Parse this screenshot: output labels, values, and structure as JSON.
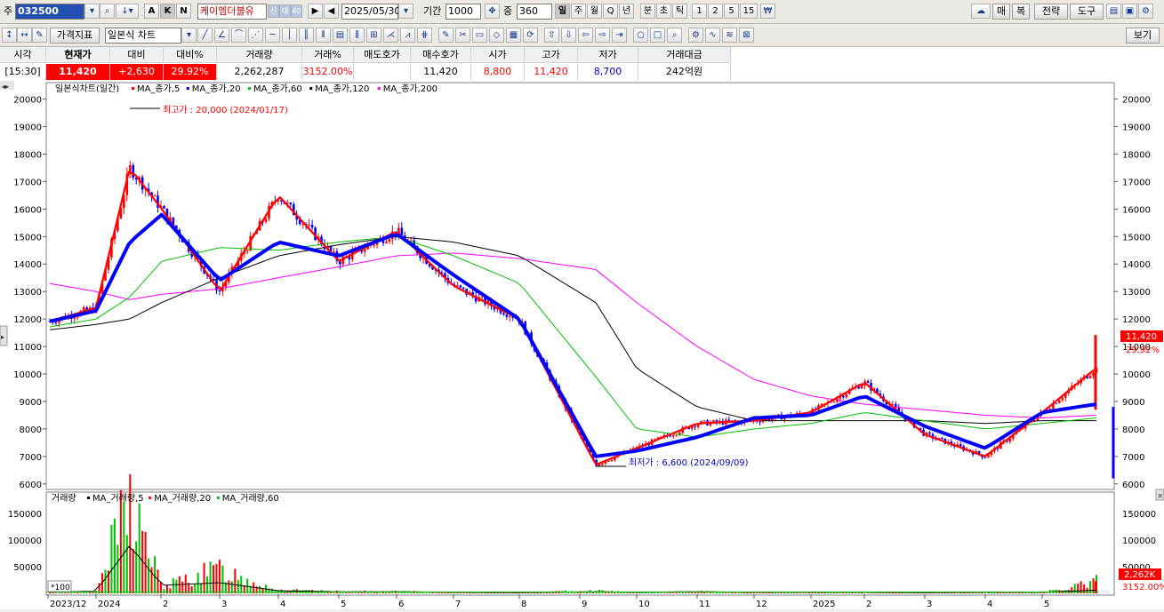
{
  "toolbar1": {
    "market_label": "주",
    "code": "032500",
    "stock_name": "케이엠더블유",
    "badges": [
      "신",
      "대",
      "40"
    ],
    "date": "2025/05/30",
    "period_label": "기간",
    "period_value": "1000",
    "mid_label": "중",
    "mid_value": "360",
    "interval_buttons": [
      "일",
      "주",
      "월",
      "Q",
      "년",
      "분",
      "초",
      "틱",
      "1",
      "2",
      "5",
      "15"
    ],
    "abk_buttons": [
      "A",
      "K",
      "N"
    ],
    "right_buttons": [
      "매",
      "복",
      "전략",
      "도구"
    ]
  },
  "toolbar2": {
    "indicator_label": "가격지표",
    "chart_type": "일본식 차트",
    "view_label": "보기"
  },
  "quote": {
    "headers": [
      "시각",
      "현재가",
      "대비",
      "대비%",
      "거래량",
      "거래%",
      "매도호가",
      "매수호가",
      "시가",
      "고가",
      "저가",
      "거래대금"
    ],
    "values": [
      "[15:30]",
      "11,420",
      "+2,630",
      "29.92%",
      "2,262,287",
      "3152.00%",
      "",
      "11,420",
      "8,800",
      "11,420",
      "8,700",
      "242억원"
    ]
  },
  "price_panel": {
    "legend_title": "일본식차트(일간)",
    "legend_items": [
      {
        "label": "MA_종가,5",
        "color": "#ff0000"
      },
      {
        "label": "MA_종가,20",
        "color": "#0000ff"
      },
      {
        "label": "MA_종가,60",
        "color": "#00c000"
      },
      {
        "label": "MA_종가,120",
        "color": "#000000"
      },
      {
        "label": "MA_종가,200",
        "color": "#ff00ff"
      }
    ],
    "high_annotation": "최고가 : 20,000 (2024/01/17)",
    "low_annotation": "최저가 : 6,600 (2024/09/09)",
    "last_price_tag": "11,420",
    "last_pct_tag": "29.92%"
  },
  "volume_panel": {
    "legend_title": "거래량",
    "legend_items": [
      {
        "label": "MA_거래량,5",
        "color": "#000000"
      },
      {
        "label": "MA_거래량,20",
        "color": "#ff0000"
      },
      {
        "label": "MA_거래량,60",
        "color": "#00c000"
      }
    ],
    "unit_label": "*100",
    "last_volume_tag": "2,262K",
    "last_pct_tag": "3152.00%"
  },
  "x_axis_labels": [
    "2023/12",
    "2024",
    "2",
    "3",
    "4",
    "5",
    "6",
    "7",
    "8",
    "9",
    "10",
    "11",
    "12",
    "2025",
    "2",
    "3",
    "4",
    "5"
  ],
  "colors": {
    "up": "#ff0000",
    "down": "#0000ff",
    "ma5": "#ff0000",
    "ma20": "#0000ff",
    "ma60": "#00c000",
    "ma120": "#000000",
    "ma200": "#ff00ff",
    "current_bg": "#ff0000"
  },
  "chart_data": [
    {
      "type": "line",
      "title": "일본식차트(일간)",
      "x": [
        "2023/12",
        "2024/01",
        "2024/01/17",
        "2024/02",
        "2024/03",
        "2024/04",
        "2024/05",
        "2024/06",
        "2024/07",
        "2024/08",
        "2024/09/09",
        "2024/10",
        "2024/11",
        "2024/12",
        "2025/01",
        "2025/02",
        "2025/03",
        "2025/04",
        "2025/05",
        "2025/05/30"
      ],
      "y_ticks": [
        6000,
        7000,
        8000,
        9000,
        10000,
        11000,
        12000,
        13000,
        14000,
        15000,
        16000,
        17000,
        18000,
        19000,
        20000
      ],
      "ylim": [
        5800,
        20600
      ],
      "grid": false,
      "legend": "top-left",
      "series": [
        {
          "name": "MA_종가,5",
          "values": [
            11900,
            12400,
            17500,
            16000,
            13000,
            16500,
            14100,
            15200,
            13200,
            12000,
            6700,
            7300,
            8200,
            8300,
            8600,
            9700,
            7800,
            7000,
            8600,
            10200
          ]
        },
        {
          "name": "MA_종가,20",
          "values": [
            11900,
            12300,
            14800,
            15800,
            13400,
            14800,
            14300,
            15100,
            13600,
            12000,
            7000,
            7200,
            7700,
            8400,
            8500,
            9200,
            8100,
            7300,
            8600,
            8900
          ]
        },
        {
          "name": "MA_종가,60",
          "values": [
            11700,
            12000,
            12800,
            14100,
            14600,
            14500,
            14800,
            15000,
            14300,
            13300,
            9900,
            8000,
            7700,
            8000,
            8200,
            8600,
            8300,
            8000,
            8200,
            8400
          ]
        },
        {
          "name": "MA_종가,120",
          "values": [
            11600,
            11800,
            12000,
            12600,
            13500,
            14300,
            14700,
            15000,
            14800,
            14300,
            12600,
            10200,
            8800,
            8300,
            8300,
            8300,
            8300,
            8200,
            8300,
            8300
          ]
        },
        {
          "name": "MA_종가,200",
          "values": [
            13300,
            13000,
            12700,
            12900,
            13100,
            13500,
            13900,
            14300,
            14400,
            14200,
            13800,
            12600,
            11000,
            9800,
            9200,
            8900,
            8700,
            8500,
            8400,
            8500
          ]
        }
      ],
      "annotations": [
        {
          "label": "최고가 : 20,000 (2024/01/17)",
          "x": "2024/01/17",
          "y": 20000
        },
        {
          "label": "최저가 : 6,600 (2024/09/09)",
          "x": "2024/09/09",
          "y": 6600
        }
      ],
      "last_value": 11420
    },
    {
      "type": "bar",
      "title": "거래량",
      "y_ticks": [
        50000,
        100000,
        150000
      ],
      "ylim": [
        0,
        190000
      ],
      "series": [
        {
          "name": "거래량",
          "values": [
            2000,
            3000,
            175000,
            12000,
            45000,
            6000,
            3000,
            3000,
            2000,
            1500,
            5000,
            2000,
            3000,
            2000,
            2000,
            2000,
            1500,
            2000,
            2000,
            22623
          ]
        },
        {
          "name": "MA_거래량,5",
          "values": [
            2000,
            4000,
            90000,
            15000,
            20000,
            5000,
            3000,
            3000,
            2000,
            1500,
            3000,
            2000,
            3000,
            2000,
            2000,
            2000,
            1500,
            2000,
            2000,
            6000
          ]
        }
      ]
    }
  ]
}
